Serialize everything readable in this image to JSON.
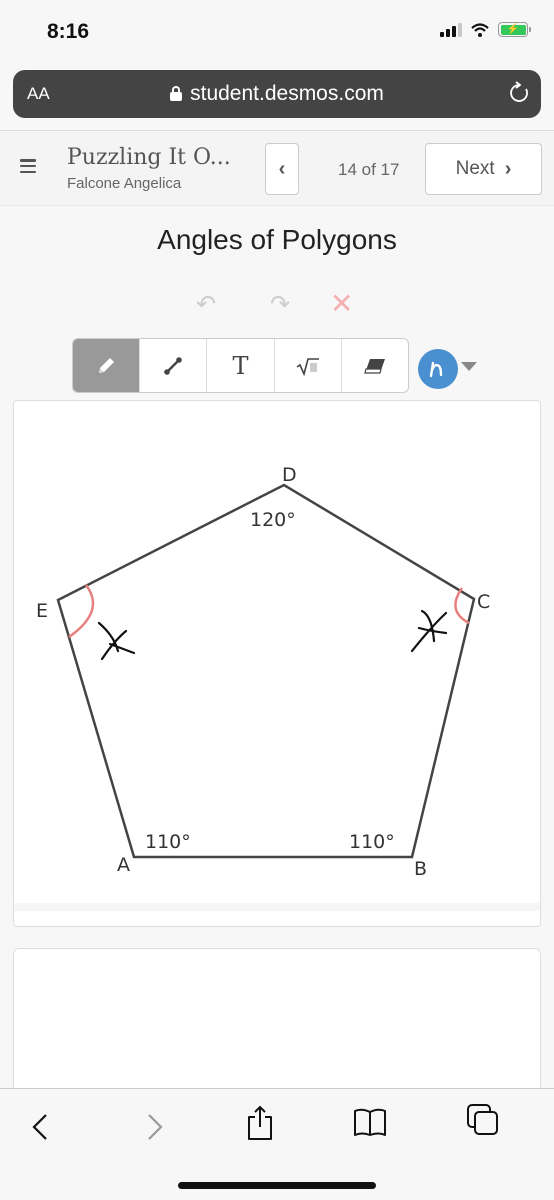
{
  "status_bar": {
    "time": "8:16",
    "icons": [
      "cellular-signal-icon",
      "wifi-icon",
      "battery-charging-icon"
    ],
    "battery_color": "#34c759"
  },
  "browser": {
    "text_size_label": "AA",
    "url": "student.desmos.com",
    "secure_icon": "lock-icon",
    "reload_icon": "reload-icon"
  },
  "activity_header": {
    "title": "Puzzling It O...",
    "student_name": "Falcone Angelica",
    "prev_label": "‹",
    "page_indicator": "14 of 17",
    "next_label": "Next",
    "next_icon": "›"
  },
  "screen": {
    "title": "Angles of Polygons",
    "history": {
      "undo_icon": "↶",
      "redo_icon": "↷",
      "clear_icon": "✕"
    },
    "tools": [
      {
        "name": "pencil",
        "icon": "✎",
        "active": true
      },
      {
        "name": "line",
        "icon": "line",
        "active": false
      },
      {
        "name": "text",
        "icon": "T",
        "active": false
      },
      {
        "name": "math",
        "icon": "√▢",
        "active": false
      },
      {
        "name": "eraser",
        "icon": "eraser",
        "active": false
      }
    ],
    "color_picker": {
      "color": "#4a8fd0",
      "glyph": "ɲ"
    }
  },
  "sketch": {
    "vertices": [
      {
        "label": "A",
        "angle": "110°"
      },
      {
        "label": "B",
        "angle": "110°"
      },
      {
        "label": "C",
        "angle": "x"
      },
      {
        "label": "D",
        "angle": "120°"
      },
      {
        "label": "E",
        "angle": "x"
      }
    ],
    "unknown_marks": [
      "x",
      "x"
    ],
    "arc_color": "#e88080"
  },
  "bottom_bar": {
    "icons": [
      "back-icon",
      "forward-icon",
      "share-icon",
      "bookmarks-icon",
      "tabs-icon"
    ]
  }
}
